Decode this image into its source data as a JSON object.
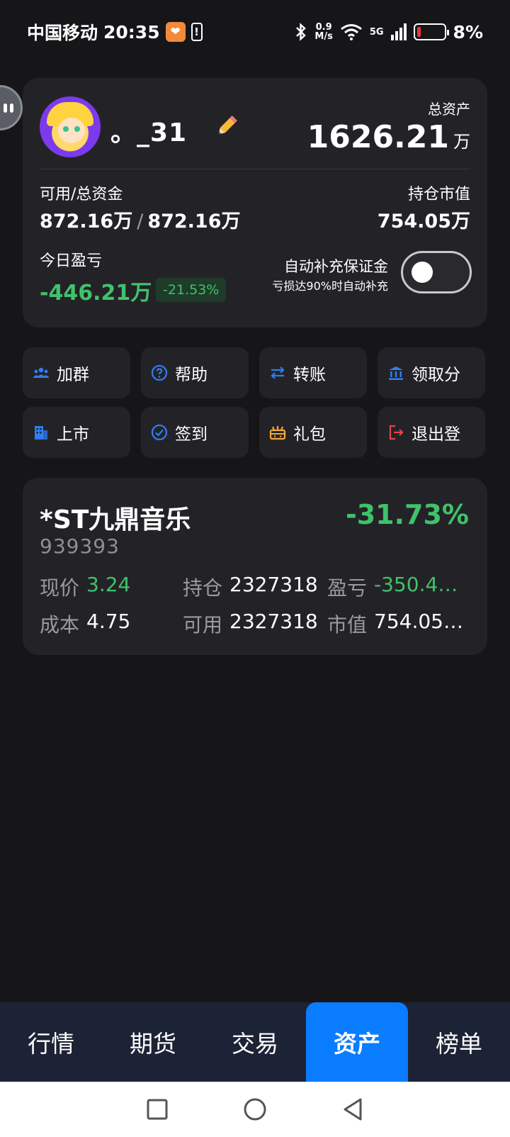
{
  "status_bar": {
    "carrier": "中国移动",
    "time": "20:35",
    "net_speed_value": "0.9",
    "net_speed_unit": "M/s",
    "signal_label": "5G",
    "battery_percent": "8%"
  },
  "account": {
    "nickname": "。_31",
    "total_assets_label": "总资产",
    "total_assets_value": "1626.21",
    "total_assets_unit": "万",
    "available_label": "可用/总资金",
    "available_value": "872.16万",
    "total_funds_value": "872.16万",
    "funds_separator": "/",
    "position_value_label": "持仓市值",
    "position_value": "754.05万",
    "today_pnl_label": "今日盈亏",
    "today_pnl_value": "-446.21万",
    "today_pnl_percent": "-21.53%",
    "auto_margin_label": "自动补充保证金",
    "auto_margin_sub": "亏损达90%时自动补充",
    "auto_margin_enabled": false
  },
  "actions": [
    {
      "label": "加群",
      "icon": "group-icon"
    },
    {
      "label": "帮助",
      "icon": "help-icon"
    },
    {
      "label": "转账",
      "icon": "transfer-icon"
    },
    {
      "label": "领取分",
      "icon": "bank-icon"
    },
    {
      "label": "上市",
      "icon": "building-icon"
    },
    {
      "label": "签到",
      "icon": "check-circle-icon"
    },
    {
      "label": "礼包",
      "icon": "gift-icon"
    },
    {
      "label": "退出登",
      "icon": "logout-icon"
    }
  ],
  "holding": {
    "name": "*ST九鼎音乐",
    "code": "939393",
    "change_percent": "-31.73%",
    "price_label": "现价",
    "price_value": "3.24",
    "cost_label": "成本",
    "cost_value": "4.75",
    "position_label": "持仓",
    "position_value": "2327318",
    "available_label": "可用",
    "available_value": "2327318",
    "pnl_label": "盈亏",
    "pnl_value": "-350.4…",
    "market_value_label": "市值",
    "market_value": "754.05…"
  },
  "tabs": [
    {
      "label": "行情",
      "active": false
    },
    {
      "label": "期货",
      "active": false
    },
    {
      "label": "交易",
      "active": false
    },
    {
      "label": "资产",
      "active": true
    },
    {
      "label": "榜单",
      "active": false
    }
  ],
  "colors": {
    "background": "#161619",
    "card": "#232327",
    "accent_blue": "#0a7cff",
    "loss_green": "#3fc26b",
    "tab_bar": "#1d2336"
  }
}
